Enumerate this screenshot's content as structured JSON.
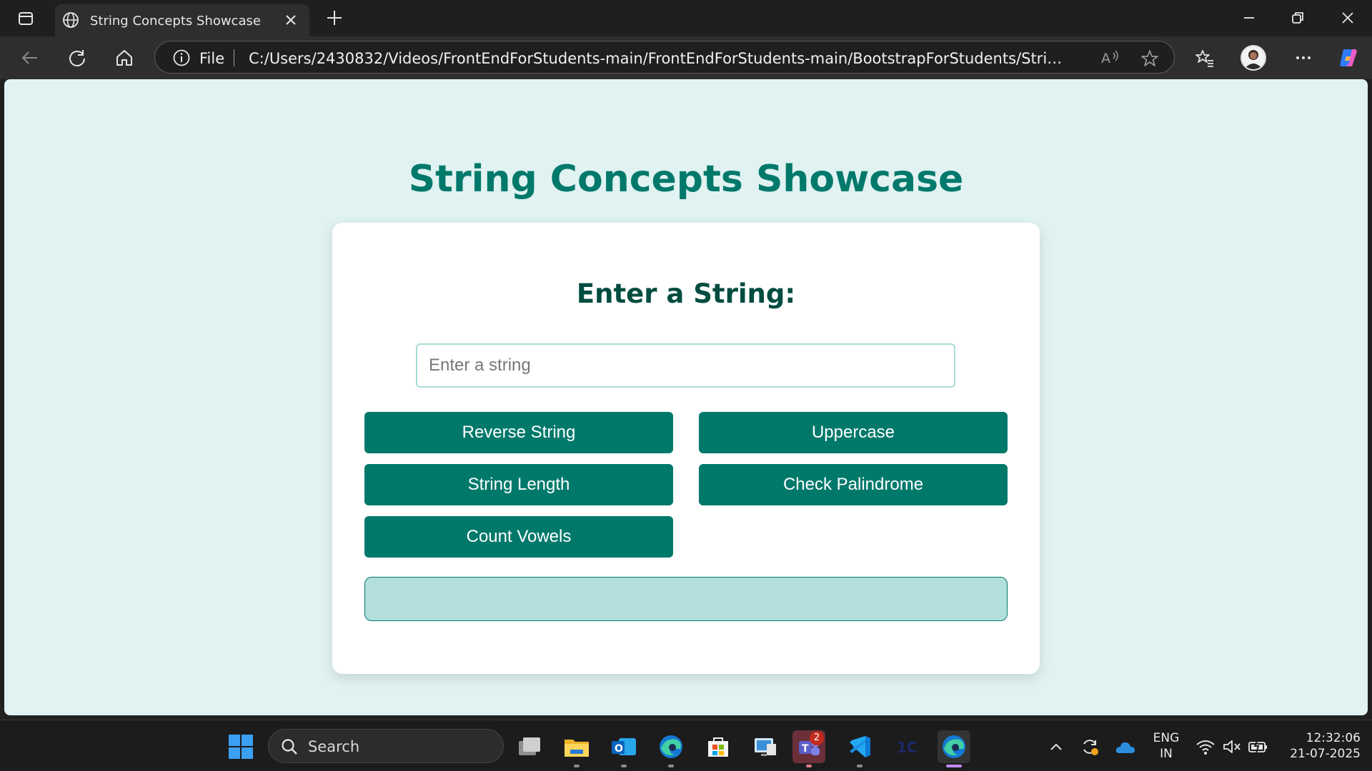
{
  "browser": {
    "tab_title": "String Concepts Showcase",
    "omnibox_scheme": "File",
    "url": "C:/Users/2430832/Videos/FrontEndForStudents-main/FrontEndForStudents-main/BootstrapForStudents/StringConcepts/ind..."
  },
  "page": {
    "title": "String Concepts Showcase",
    "card_heading": "Enter a String:",
    "input_placeholder": "Enter a string",
    "input_value": "",
    "buttons": {
      "reverse": "Reverse String",
      "uppercase": "Uppercase",
      "length": "String Length",
      "palindrome": "Check Palindrome",
      "vowels": "Count Vowels"
    },
    "result": ""
  },
  "taskbar": {
    "search_label": "Search",
    "teams_badge": "2",
    "lang_top": "ENG",
    "lang_bottom": "IN",
    "time": "12:32:06",
    "date": "21-07-2025"
  },
  "colors": {
    "page_bg": "#e0f2f1",
    "accent": "#00796b",
    "heading": "#004d40",
    "result_bg": "#b2dfdb"
  }
}
